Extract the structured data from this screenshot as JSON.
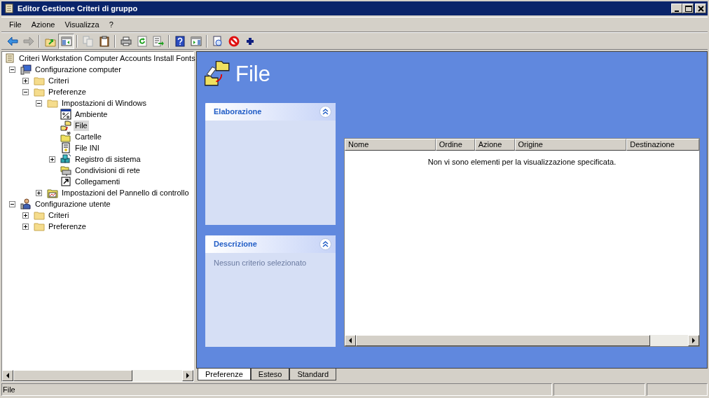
{
  "window": {
    "title": "Editor Gestione Criteri di gruppo"
  },
  "menu": [
    "File",
    "Azione",
    "Visualizza",
    "?"
  ],
  "toolbar": [
    [
      {
        "kind": "back",
        "disabled": false,
        "pressed": false
      },
      {
        "kind": "forward",
        "disabled": true,
        "pressed": false
      }
    ],
    [
      {
        "kind": "up",
        "disabled": false,
        "pressed": false
      },
      {
        "kind": "tree",
        "disabled": false,
        "pressed": true
      }
    ],
    [
      {
        "kind": "copy",
        "disabled": true,
        "pressed": false
      },
      {
        "kind": "paste",
        "disabled": false,
        "pressed": false
      }
    ],
    [
      {
        "kind": "print",
        "disabled": false,
        "pressed": false
      },
      {
        "kind": "refresh",
        "disabled": false,
        "pressed": false
      },
      {
        "kind": "export",
        "disabled": false,
        "pressed": false
      }
    ],
    [
      {
        "kind": "help",
        "disabled": false,
        "pressed": false
      },
      {
        "kind": "pane",
        "disabled": false,
        "pressed": false
      }
    ],
    [
      {
        "kind": "properties",
        "disabled": false,
        "pressed": false
      },
      {
        "kind": "stop",
        "disabled": false,
        "pressed": false
      },
      {
        "kind": "add",
        "disabled": false,
        "pressed": false
      }
    ]
  ],
  "tree": {
    "label": "Criteri Workstation Computer Accounts Install Fonts",
    "kind": "scroll",
    "selected": false,
    "children": [
      {
        "label": "Configurazione computer",
        "kind": "computer",
        "expanded": true,
        "selected": false,
        "children": [
          {
            "label": "Criteri",
            "kind": "folder",
            "expanded": false,
            "selected": false
          },
          {
            "label": "Preferenze",
            "kind": "folder",
            "expanded": true,
            "selected": false,
            "children": [
              {
                "label": "Impostazioni di Windows",
                "kind": "folder",
                "expanded": true,
                "selected": false,
                "children": [
                  {
                    "label": "Ambiente",
                    "kind": "env",
                    "selected": false
                  },
                  {
                    "label": "File",
                    "kind": "filepref",
                    "selected": true
                  },
                  {
                    "label": "Cartelle",
                    "kind": "folderpref",
                    "selected": false
                  },
                  {
                    "label": "File INI",
                    "kind": "ini",
                    "selected": false
                  },
                  {
                    "label": "Registro di sistema",
                    "kind": "registry",
                    "expanded": false,
                    "selected": false
                  },
                  {
                    "label": "Condivisioni di rete",
                    "kind": "share",
                    "selected": false
                  },
                  {
                    "label": "Collegamenti",
                    "kind": "shortcut",
                    "selected": false
                  }
                ]
              },
              {
                "label": "Impostazioni del Pannello di controllo",
                "kind": "control",
                "expanded": false,
                "selected": false
              }
            ]
          }
        ]
      },
      {
        "label": "Configurazione utente",
        "kind": "user",
        "expanded": true,
        "selected": false,
        "children": [
          {
            "label": "Criteri",
            "kind": "folder",
            "expanded": false,
            "selected": false
          },
          {
            "label": "Preferenze",
            "kind": "folder",
            "expanded": false,
            "selected": false
          }
        ]
      }
    ]
  },
  "header": {
    "title": "File"
  },
  "panels": [
    {
      "title": "Elaborazione",
      "expanded": true
    },
    {
      "title": "Descrizione",
      "expanded": true,
      "text": "Nessun criterio selezionato"
    }
  ],
  "list": {
    "columns": [
      "Nome",
      "Ordine",
      "Azione",
      "Origine",
      "Destinazione"
    ],
    "empty_message": "Non vi sono elementi per la visualizzazione specificata."
  },
  "tabs": [
    {
      "label": "Preferenze",
      "selected": true
    },
    {
      "label": "Esteso",
      "selected": false
    },
    {
      "label": "Standard",
      "selected": false
    }
  ],
  "status_bar": {
    "text": "File"
  }
}
